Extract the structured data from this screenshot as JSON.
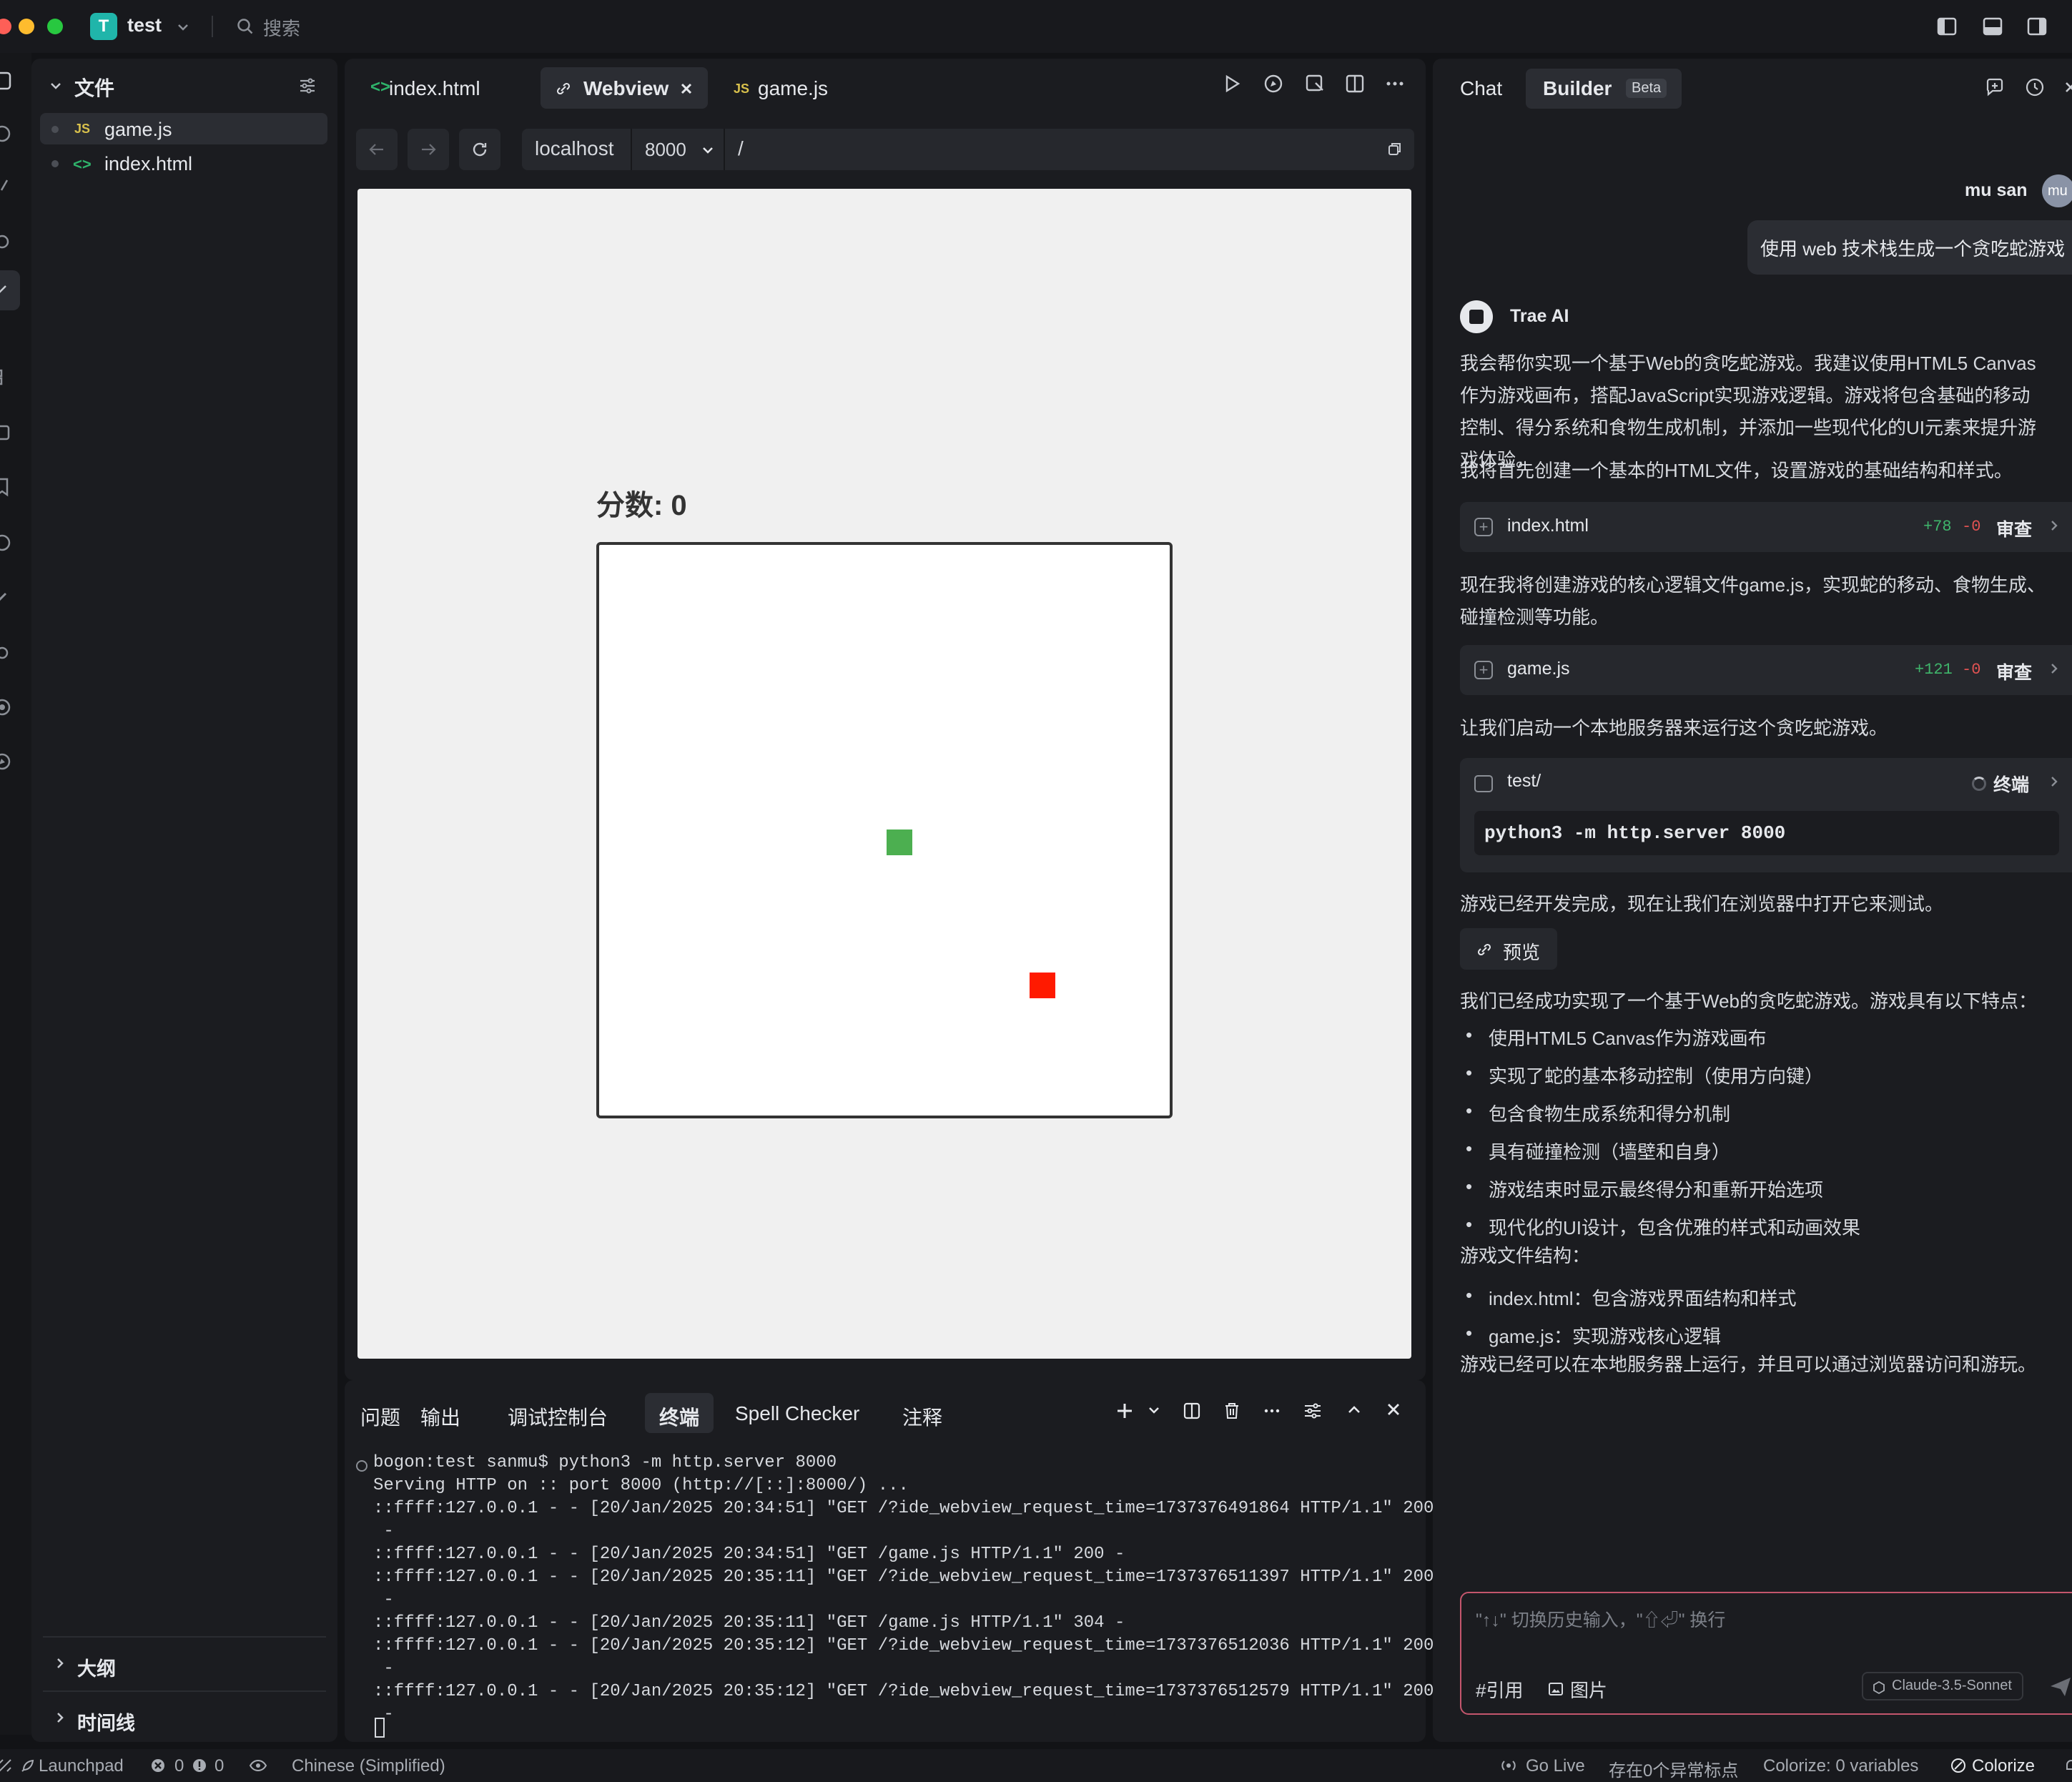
{
  "titlebar": {
    "project_badge": "T",
    "project_name": "test",
    "search_placeholder": "搜索"
  },
  "explorer": {
    "title": "文件",
    "files": [
      {
        "icon": "JS",
        "name": "game.js"
      },
      {
        "icon": "<>",
        "name": "index.html"
      }
    ],
    "sections": [
      "大纲",
      "时间线"
    ]
  },
  "editor": {
    "tabs": [
      {
        "icon": "<>",
        "label": "index.html"
      },
      {
        "icon": "link-icon",
        "label": "Webview"
      },
      {
        "icon": "JS",
        "label": "game.js"
      }
    ],
    "url": {
      "host": "localhost",
      "port": "8000",
      "path": "/"
    }
  },
  "webview": {
    "score_text": "分数: 0",
    "colors": {
      "snake": "#4caf50",
      "food": "#ff1a00"
    }
  },
  "panel": {
    "tabs": [
      "问题",
      "输出",
      "调试控制台",
      "终端",
      "Spell Checker",
      "注释"
    ],
    "active_tab": "终端",
    "terminal_lines": [
      "bogon:test sanmu$ python3 -m http.server 8000",
      "Serving HTTP on :: port 8000 (http://[::]:8000/) ...",
      "::ffff:127.0.0.1 - - [20/Jan/2025 20:34:51] \"GET /?ide_webview_request_time=1737376491864 HTTP/1.1\" 200",
      " -",
      "::ffff:127.0.0.1 - - [20/Jan/2025 20:34:51] \"GET /game.js HTTP/1.1\" 200 -",
      "::ffff:127.0.0.1 - - [20/Jan/2025 20:35:11] \"GET /?ide_webview_request_time=1737376511397 HTTP/1.1\" 200",
      " -",
      "::ffff:127.0.0.1 - - [20/Jan/2025 20:35:11] \"GET /game.js HTTP/1.1\" 304 -",
      "::ffff:127.0.0.1 - - [20/Jan/2025 20:35:12] \"GET /?ide_webview_request_time=1737376512036 HTTP/1.1\" 200",
      " -",
      "::ffff:127.0.0.1 - - [20/Jan/2025 20:35:12] \"GET /?ide_webview_request_time=1737376512579 HTTP/1.1\" 200",
      " -"
    ]
  },
  "chat": {
    "tab_chat": "Chat",
    "tab_builder": "Builder",
    "beta_badge": "Beta",
    "user": {
      "name": "mu san",
      "avatar": "mu",
      "message": "使用 web 技术栈生成一个贪吃蛇游戏"
    },
    "ai_name": "Trae AI",
    "p1": "我会帮你实现一个基于Web的贪吃蛇游戏。我建议使用HTML5 Canvas作为游戏画布，搭配JavaScript实现游戏逻辑。游戏将包含基础的移动控制、得分系统和食物生成机制，并添加一些现代化的UI元素来提升游戏体验。",
    "p2": "我将首先创建一个基本的HTML文件，设置游戏的基础结构和样式。",
    "card1": {
      "name": "index.html",
      "added": "+78",
      "removed": "-0",
      "review": "审查"
    },
    "p3": "现在我将创建游戏的核心逻辑文件game.js，实现蛇的移动、食物生成、碰撞检测等功能。",
    "card2": {
      "name": "game.js",
      "added": "+121",
      "removed": "-0",
      "review": "审查"
    },
    "p4": "让我们启动一个本地服务器来运行这个贪吃蛇游戏。",
    "term_card": {
      "path": "test/",
      "label": "终端",
      "command": "python3 -m http.server 8000"
    },
    "p5": "游戏已经开发完成，现在让我们在浏览器中打开它来测试。",
    "preview": "预览",
    "p6": "我们已经成功实现了一个基于Web的贪吃蛇游戏。游戏具有以下特点：",
    "features": [
      "使用HTML5 Canvas作为游戏画布",
      "实现了蛇的基本移动控制（使用方向键）",
      "包含食物生成系统和得分机制",
      "具有碰撞检测（墙壁和自身）",
      "游戏结束时显示最终得分和重新开始选项",
      "现代化的UI设计，包含优雅的样式和动画效果"
    ],
    "p7": "游戏文件结构：",
    "structure": [
      "index.html：包含游戏界面结构和样式",
      "game.js：实现游戏核心逻辑"
    ],
    "p8": "游戏已经可以在本地服务器上运行，并且可以通过浏览器访问和游玩。",
    "input_placeholder": "\"↑↓\" 切换历史输入，\"⇧⏎\" 换行",
    "ref_label": "#引用",
    "image_label": "图片",
    "model": "Claude-3.5-Sonnet"
  },
  "statusbar": {
    "launchpad": "Launchpad",
    "errors": "0",
    "warnings": "0",
    "language": "Chinese (Simplified)",
    "go_live": "Go Live",
    "breakpoints": "存在0个异常标点",
    "colorize_vars": "Colorize: 0 variables",
    "colorize": "Colorize"
  }
}
